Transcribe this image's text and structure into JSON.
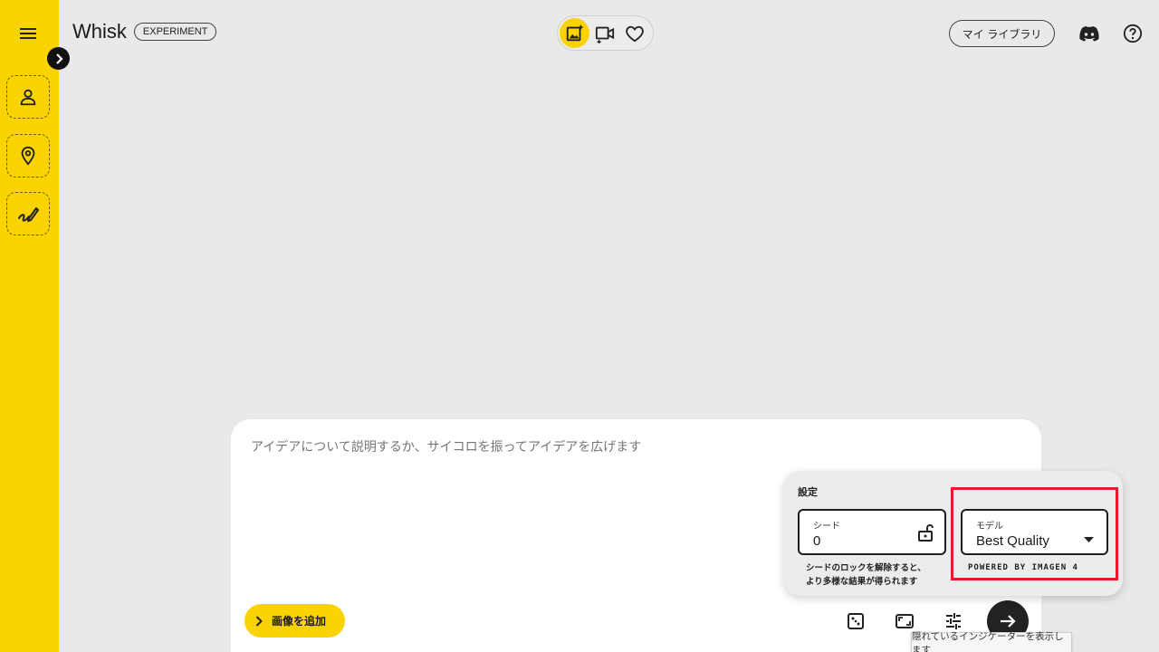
{
  "app": {
    "name": "Whisk",
    "badge": "EXPERIMENT"
  },
  "sidebar": {
    "slots": [
      {
        "icon": "person-icon"
      },
      {
        "icon": "location-pin-icon"
      },
      {
        "icon": "brush-icon"
      }
    ]
  },
  "header": {
    "modes": [
      {
        "icon": "image-sparkle-icon",
        "active": true
      },
      {
        "icon": "video-sparkle-icon",
        "active": false
      },
      {
        "icon": "heart-icon",
        "active": false
      }
    ],
    "library_label": "マイ ライブラリ"
  },
  "prompt": {
    "placeholder": "アイデアについて説明するか、サイコロを振ってアイデアを広げます",
    "add_image_label": "画像を追加"
  },
  "settings": {
    "title": "設定",
    "seed": {
      "label": "シード",
      "value": "0",
      "note_line1": "シードのロックを解除すると、",
      "note_line2": "より多様な結果が得られます"
    },
    "model": {
      "label": "モデル",
      "value": "Best Quality",
      "powered_by": "POWERED BY IMAGEN 4"
    }
  },
  "tooltip": "隠れているインジケーターを表示します",
  "colors": {
    "accent": "#fad300",
    "highlight": "#e51c2c",
    "background": "#e9e9e9"
  }
}
